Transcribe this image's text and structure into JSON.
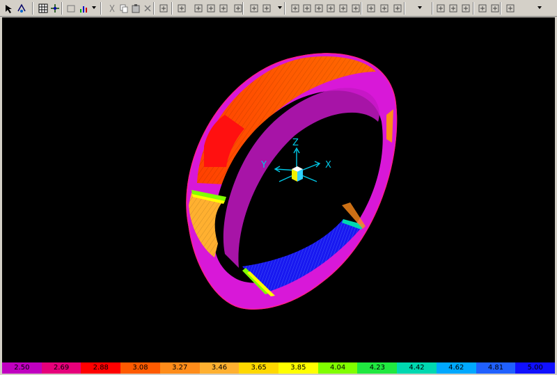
{
  "toolbar": {
    "buttons": [
      {
        "name": "select-pointer-icon"
      },
      {
        "name": "rotate-view-icon"
      },
      {
        "name": "mesh-grid-icon"
      },
      {
        "name": "coordinate-system-icon"
      },
      {
        "name": "new-model-icon"
      },
      {
        "name": "results-plot-icon"
      },
      {
        "name": "cut-icon"
      },
      {
        "name": "copy-icon"
      },
      {
        "name": "paste-icon"
      },
      {
        "name": "delete-icon"
      },
      {
        "name": "node-numbering-icon"
      },
      {
        "name": "element-grid-icon"
      },
      {
        "name": "support-icon"
      },
      {
        "name": "beam-icon"
      },
      {
        "name": "frame-icon"
      },
      {
        "name": "section-icon"
      },
      {
        "name": "align-icon"
      },
      {
        "name": "distribute-icon"
      },
      {
        "name": "dimension-icon"
      },
      {
        "name": "span-icon"
      },
      {
        "name": "width-icon"
      },
      {
        "name": "spring-icon"
      },
      {
        "name": "link-icon"
      },
      {
        "name": "load-icon"
      },
      {
        "name": "stairs-icon"
      },
      {
        "name": "chart-icon"
      },
      {
        "name": "tools-icon"
      },
      {
        "name": "mesh-icon"
      },
      {
        "name": "edit-icon"
      },
      {
        "name": "report-icon"
      },
      {
        "name": "settings-icon"
      },
      {
        "name": "axes-icon"
      },
      {
        "name": "display-options-icon"
      }
    ]
  },
  "viewport": {
    "axis_labels": {
      "z": "Z",
      "y": "Y",
      "x": "X"
    },
    "colors": {
      "background": "#000000",
      "axis": "#00c8e6"
    }
  },
  "legend": {
    "values": [
      "2.50",
      "2.69",
      "2.88",
      "3.08",
      "3.27",
      "3.46",
      "3.65",
      "3.85",
      "4.04",
      "4.23",
      "4.42",
      "4.62",
      "4.81",
      "5.00"
    ],
    "colors": [
      "#c000c0",
      "#e6007a",
      "#ff0000",
      "#ff5a00",
      "#ff8c1a",
      "#ffb030",
      "#ffd800",
      "#ffff00",
      "#80ff00",
      "#20e840",
      "#00d8b0",
      "#00a8ff",
      "#2060ff",
      "#1010ff"
    ]
  }
}
